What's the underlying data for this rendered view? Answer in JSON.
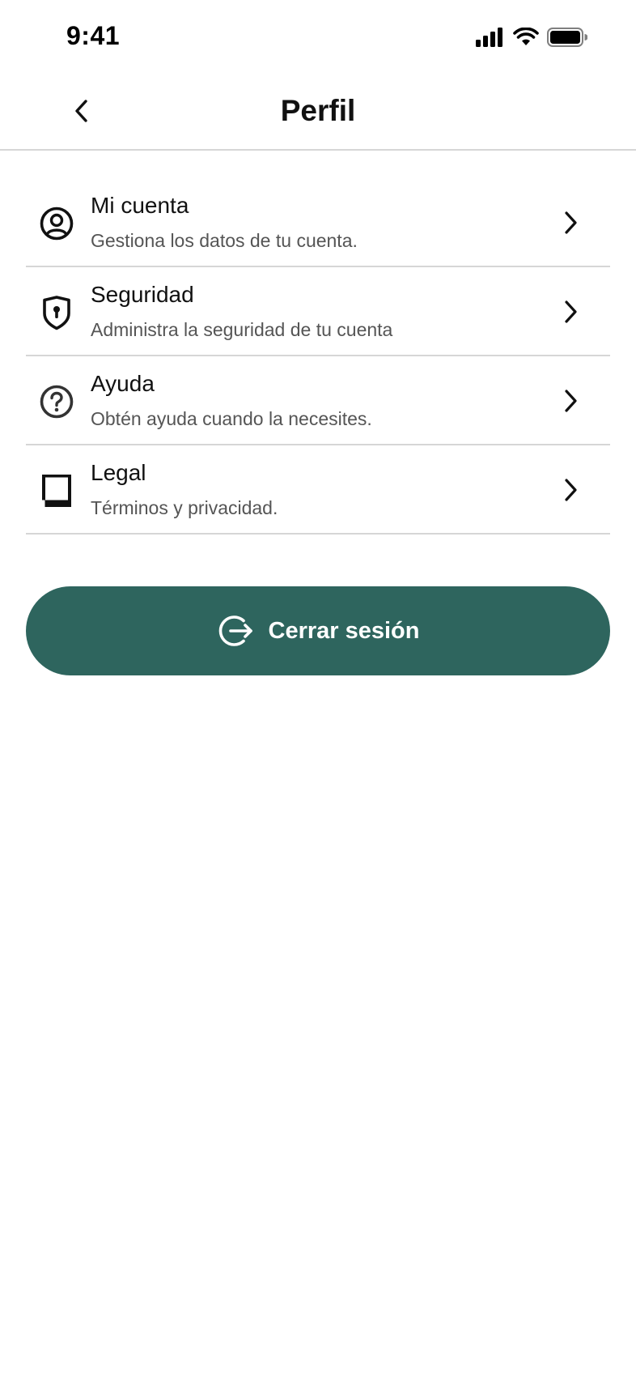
{
  "status_bar": {
    "time": "9:41"
  },
  "header": {
    "title": "Perfil"
  },
  "menu": {
    "items": [
      {
        "title": "Mi cuenta",
        "subtitle": "Gestiona los datos de tu cuenta.",
        "icon": "user-circle-icon"
      },
      {
        "title": "Seguridad",
        "subtitle": "Administra la seguridad de tu cuenta",
        "icon": "shield-icon"
      },
      {
        "title": "Ayuda",
        "subtitle": "Obtén ayuda cuando la necesites.",
        "icon": "help-circle-icon"
      },
      {
        "title": "Legal",
        "subtitle": "Términos y privacidad.",
        "icon": "document-icon"
      }
    ]
  },
  "logout": {
    "label": "Cerrar sesión",
    "icon": "logout-icon"
  },
  "colors": {
    "accent": "#2e655e",
    "divider": "#d6d6d6",
    "subtitle": "#555555"
  }
}
